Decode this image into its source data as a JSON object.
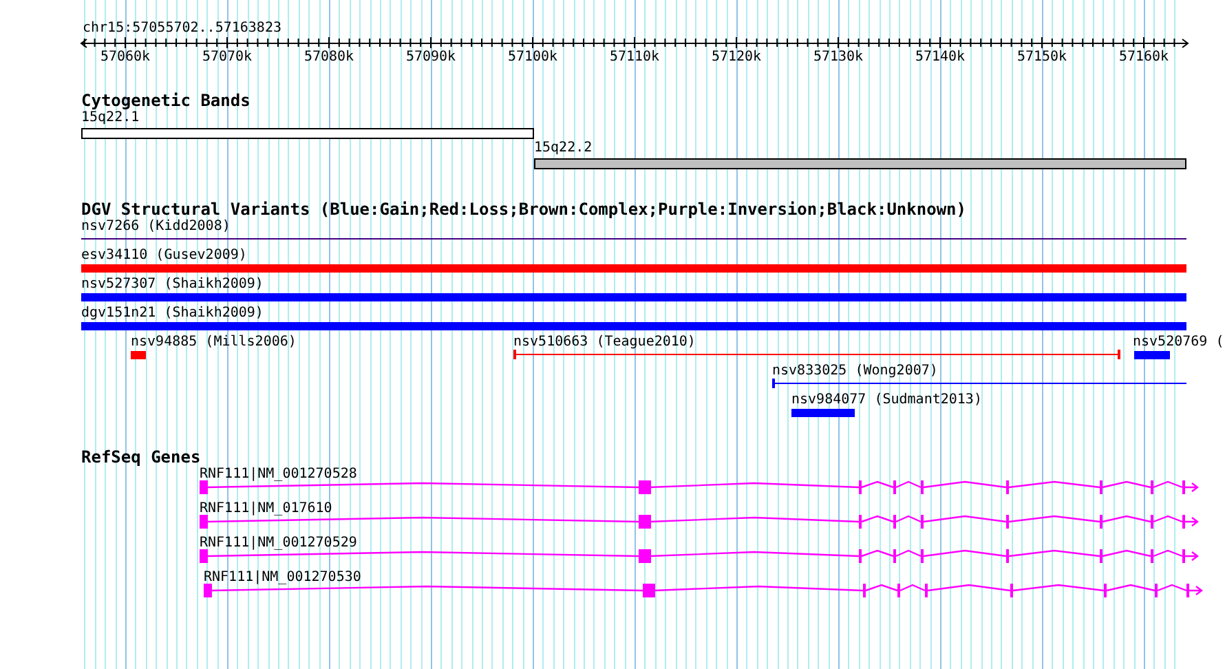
{
  "ruler": {
    "location": "chr15:57055702..57163823",
    "ticks": [
      "57060k",
      "57070k",
      "57080k",
      "57090k",
      "57100k",
      "57110k",
      "57120k",
      "57130k",
      "57140k",
      "57150k",
      "57160k"
    ]
  },
  "tracks": [
    {
      "title": "Cytogenetic Bands",
      "features": [
        {
          "label": "15q22.1",
          "kind": "band",
          "color": "#ffffff"
        },
        {
          "label": "15q22.2",
          "kind": "band",
          "color": "#c0c0c0"
        }
      ]
    },
    {
      "title": "DGV Structural Variants (Blue:Gain;Red:Loss;Brown:Complex;Purple:Inversion;Black:Unknown)",
      "features": [
        {
          "label": "nsv7266 (Kidd2008)",
          "kind": "line",
          "color": "#400080"
        },
        {
          "label": "esv34110 (Gusev2009)",
          "kind": "bar",
          "color": "#ff0000"
        },
        {
          "label": "nsv527307 (Shaikh2009)",
          "kind": "bar",
          "color": "#0000ff"
        },
        {
          "label": "dgv151n21 (Shaikh2009)",
          "kind": "bar",
          "color": "#0000ff"
        },
        {
          "label": "nsv94885 (Mills2006)",
          "kind": "bar",
          "color": "#ff0000"
        },
        {
          "label": "nsv510663 (Teague2010)",
          "kind": "span",
          "color": "#ff0000"
        },
        {
          "label": "nsv520769 (",
          "kind": "bar",
          "color": "#0000ff"
        },
        {
          "label": "nsv833025 (Wong2007)",
          "kind": "span",
          "color": "#0000ff"
        },
        {
          "label": "nsv984077 (Sudmant2013)",
          "kind": "bar",
          "color": "#0000ff"
        }
      ]
    },
    {
      "title": "RefSeq Genes",
      "features": [
        {
          "label": "RNF111|NM_001270528",
          "kind": "transcript"
        },
        {
          "label": "RNF111|NM_017610",
          "kind": "transcript"
        },
        {
          "label": "RNF111|NM_001270529",
          "kind": "transcript"
        },
        {
          "label": "RNF111|NM_001270530",
          "kind": "transcript"
        }
      ]
    }
  ]
}
